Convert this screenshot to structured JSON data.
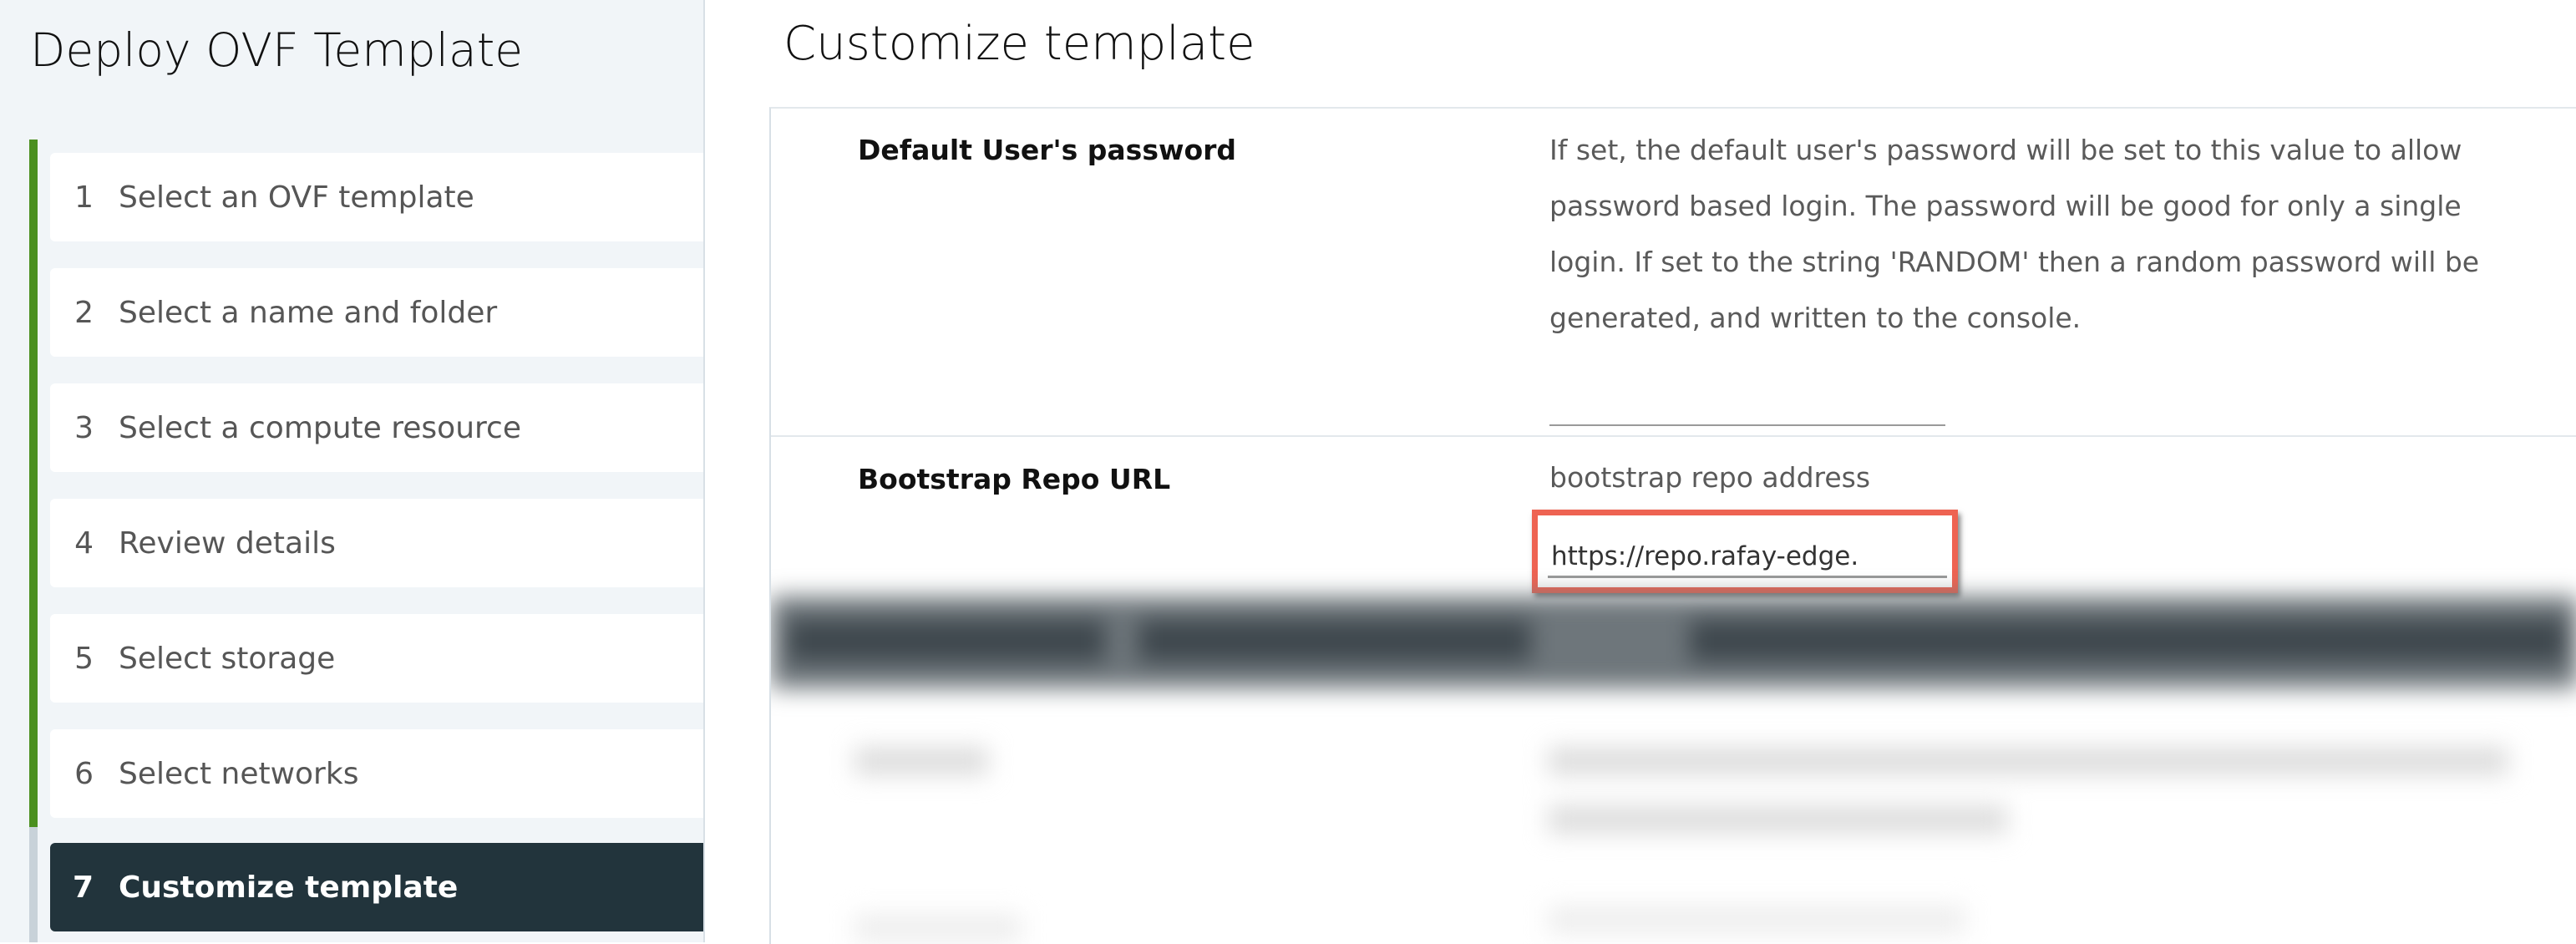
{
  "wizard": {
    "title": "Deploy OVF Template",
    "steps": [
      {
        "num": "1",
        "label": "Select an OVF template"
      },
      {
        "num": "2",
        "label": "Select a name and folder"
      },
      {
        "num": "3",
        "label": "Select a compute resource"
      },
      {
        "num": "4",
        "label": "Review details"
      },
      {
        "num": "5",
        "label": "Select storage"
      },
      {
        "num": "6",
        "label": "Select networks"
      },
      {
        "num": "7",
        "label": "Customize template"
      }
    ],
    "active_step": 7,
    "completed_color": "#4b8f1f",
    "active_color": "#22343c"
  },
  "main": {
    "title": "Customize template",
    "properties": [
      {
        "label": "Default User's password",
        "description_lines": [
          "If set, the default user's password will be set to this value to allow",
          "password based login.  The password will be good for only a single",
          "login.  If set to the string 'RANDOM' then a random password will be",
          "generated, and written to the console."
        ],
        "value": ""
      },
      {
        "label": "Bootstrap Repo URL",
        "description": "bootstrap repo address",
        "value": "https://repo.rafay-edge."
      }
    ],
    "highlight_color": "#ee6352"
  }
}
